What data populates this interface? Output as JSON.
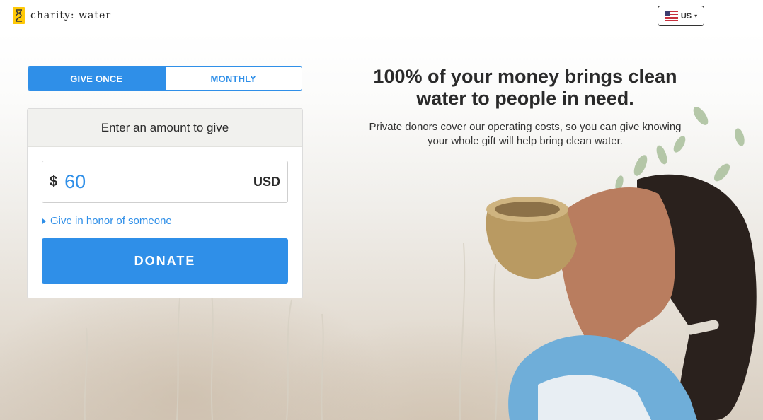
{
  "header": {
    "logo_text": "charity: water",
    "country_selector": {
      "label": "US"
    }
  },
  "donation_form": {
    "frequency_tabs": [
      {
        "label": "GIVE ONCE",
        "selected": true
      },
      {
        "label": "MONTHLY",
        "selected": false
      }
    ],
    "card_title": "Enter an amount to give",
    "amount": {
      "currency_symbol": "$",
      "value": "60",
      "currency_code": "USD"
    },
    "honor_link": "Give in honor of someone",
    "donate_label": "DONATE"
  },
  "hero": {
    "headline": "100% of your money brings clean water to people in need.",
    "subtext": "Private donors cover our operating costs, so you can give knowing your whole gift will help bring clean water."
  },
  "colors": {
    "accent_blue": "#2f8fe8",
    "logo_yellow": "#ffc907",
    "card_header_bg": "#f1f1ee"
  },
  "icons": {
    "logo": "jerry-can-icon",
    "country_flag": "us-flag-icon",
    "country_caret": "caret-down-icon",
    "honor_caret": "caret-right-icon"
  }
}
